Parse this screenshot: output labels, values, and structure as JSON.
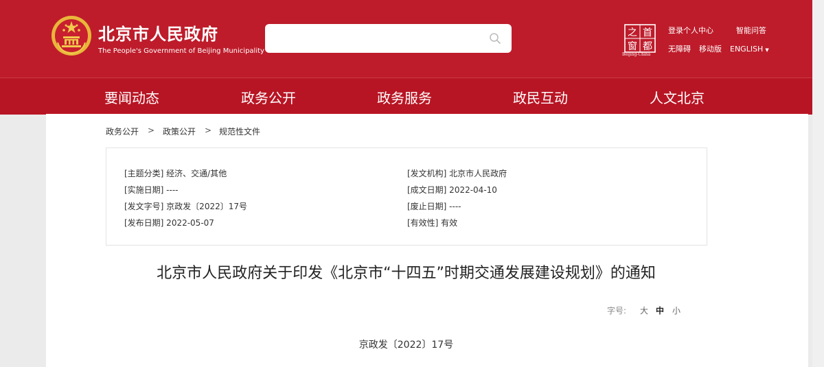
{
  "header": {
    "title": "北京市人民政府",
    "subtitle": "The People's Government of Beijing Municipality",
    "search": {
      "value": "",
      "placeholder": ""
    },
    "capital_logo_text": [
      "首",
      "都",
      "之",
      "窗"
    ],
    "capital_logo_caption": "Beijing-China",
    "links": {
      "login": "登录个人中心",
      "smart_qa": "智能问答",
      "accessibility": "无障碍",
      "mobile": "移动版",
      "english": "ENGLISH"
    }
  },
  "nav": {
    "items": [
      {
        "label": "要闻动态"
      },
      {
        "label": "政务公开"
      },
      {
        "label": "政务服务"
      },
      {
        "label": "政民互动"
      },
      {
        "label": "人文北京"
      }
    ]
  },
  "breadcrumb": {
    "items": [
      "政务公开",
      "政策公开",
      "规范性文件"
    ],
    "separator": ">"
  },
  "meta": {
    "left": [
      "[主题分类] 经济、交通/其他",
      "[实施日期] ----",
      "[发文字号] 京政发〔2022〕17号",
      "[发布日期] 2022-05-07"
    ],
    "right": [
      "[发文机构] 北京市人民政府",
      "[成文日期] 2022-04-10",
      "[废止日期] ----",
      "[有效性] 有效"
    ]
  },
  "document": {
    "title": "北京市人民政府关于印发《北京市“十四五”时期交通发展建设规划》的通知",
    "number": "京政发〔2022〕17号"
  },
  "font_size": {
    "label": "字号:",
    "options": [
      "大",
      "中",
      "小"
    ],
    "selected": "中"
  },
  "colors": {
    "header_red": "#be1c2b",
    "nav_red": "#b81524",
    "emblem_gold": "#f2c94c"
  }
}
